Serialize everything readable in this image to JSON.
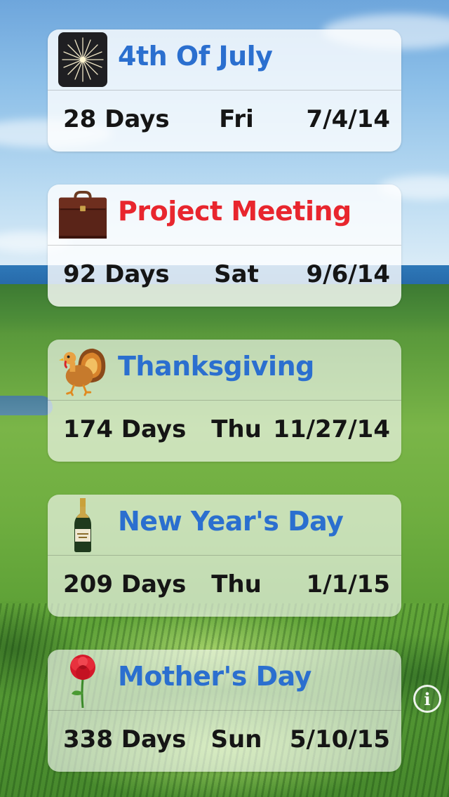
{
  "events": [
    {
      "title": "4th Of July",
      "title_color": "#2b6fcf",
      "icon": "fireworks-icon",
      "days": "28 Days",
      "weekday": "Fri",
      "date": "7/4/14"
    },
    {
      "title": "Project Meeting",
      "title_color": "#e8262e",
      "icon": "briefcase-icon",
      "days": "92 Days",
      "weekday": "Sat",
      "date": "9/6/14"
    },
    {
      "title": "Thanksgiving",
      "title_color": "#2b6fcf",
      "icon": "turkey-icon",
      "days": "174 Days",
      "weekday": "Thu",
      "date": "11/27/14"
    },
    {
      "title": "New Year's Day",
      "title_color": "#2b6fcf",
      "icon": "champagne-icon",
      "days": "209 Days",
      "weekday": "Thu",
      "date": "1/1/15"
    },
    {
      "title": "Mother's Day",
      "title_color": "#2b6fcf",
      "icon": "rose-icon",
      "days": "338 Days",
      "weekday": "Sun",
      "date": "5/10/15"
    }
  ],
  "info_button": {
    "icon": "info-icon",
    "glyph": "i"
  }
}
